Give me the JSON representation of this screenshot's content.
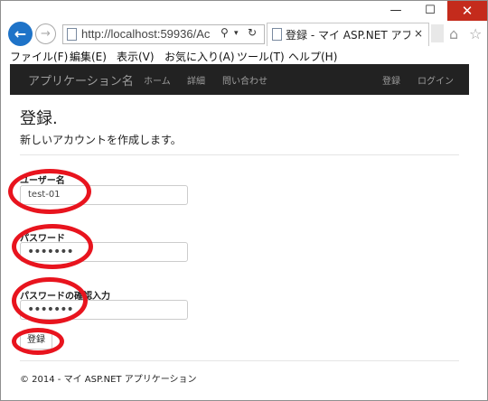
{
  "window": {
    "minimize_glyph": "—",
    "maximize_glyph": "☐",
    "close_glyph": "✕"
  },
  "browser": {
    "url": "http://localhost:59936/Ac",
    "tab_title": "登録 - マイ ASP.NET アプ...",
    "tab_close": "×"
  },
  "icons": {
    "back": "back-arrow-icon",
    "forward": "forward-arrow-icon",
    "search": "search-icon",
    "refresh": "refresh-icon",
    "home": "home-icon",
    "favorites": "star-icon"
  },
  "menu": {
    "items": [
      "ファイル(F)",
      "編集(E)",
      "表示(V)",
      "お気に入り(A)",
      "ツール(T)",
      "ヘルプ(H)"
    ]
  },
  "navbar": {
    "brand": "アプリケーション名",
    "links": [
      "ホーム",
      "詳細",
      "問い合わせ"
    ],
    "right_links": [
      "登録",
      "ログイン"
    ]
  },
  "page": {
    "title": "登録.",
    "subtitle": "新しいアカウントを作成します。",
    "fields": [
      {
        "label": "ユーザー名",
        "value": "test-01"
      },
      {
        "label": "パスワード",
        "value": "•••••••"
      },
      {
        "label": "パスワードの確認入力",
        "value": "•••••••"
      }
    ],
    "submit_label": "登録",
    "footer": "© 2014 - マイ ASP.NET アプリケーション"
  },
  "colors": {
    "annotation_ring": "#e8141e",
    "navbar_bg": "#222222",
    "back_button": "#1e73c8",
    "close_button": "#c42b1c"
  }
}
